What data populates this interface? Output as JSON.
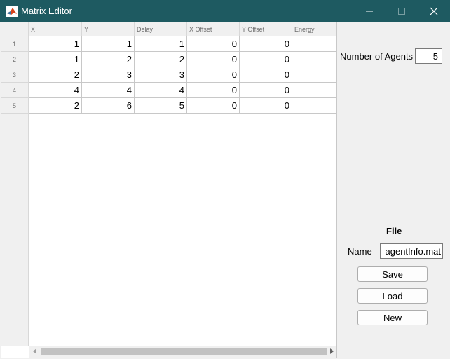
{
  "window": {
    "title": "Matrix Editor",
    "titlebar_color": "#1e5a61"
  },
  "table": {
    "columns": [
      "X",
      "Y",
      "Delay",
      "X Offset",
      "Y Offset",
      "Energy"
    ],
    "row_numbers": [
      "1",
      "2",
      "3",
      "4",
      "5"
    ],
    "rows": [
      [
        "1",
        "1",
        "1",
        "0",
        "0",
        ""
      ],
      [
        "1",
        "2",
        "2",
        "0",
        "0",
        ""
      ],
      [
        "2",
        "3",
        "3",
        "0",
        "0",
        ""
      ],
      [
        "4",
        "4",
        "4",
        "0",
        "0",
        ""
      ],
      [
        "2",
        "6",
        "5",
        "0",
        "0",
        ""
      ]
    ]
  },
  "side_panel": {
    "num_agents_label": "Number of Agents",
    "num_agents_value": "5",
    "file_heading": "File",
    "name_label": "Name",
    "name_value": "agentInfo.mat",
    "save_label": "Save",
    "load_label": "Load",
    "new_label": "New"
  },
  "icons": {
    "app": "matlab-icon",
    "minimize": "minimize-icon",
    "maximize": "maximize-icon",
    "close": "close-icon"
  }
}
